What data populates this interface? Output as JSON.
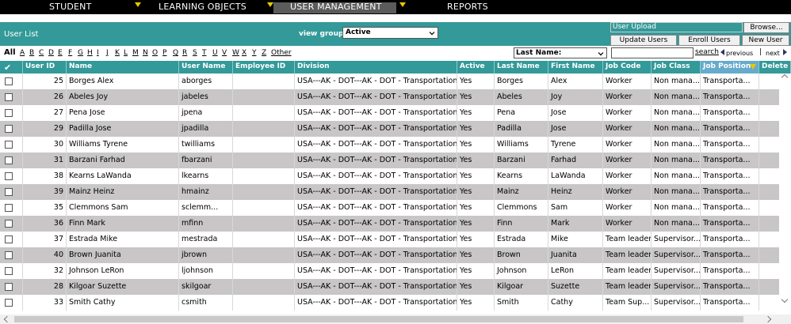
{
  "nav": {
    "items": [
      "STUDENT",
      "LEARNING OBJECTS",
      "USER MANAGEMENT",
      "REPORTS"
    ]
  },
  "header": {
    "title": "User List",
    "view_group_label": "view group",
    "view_group_value": "Active",
    "upload_label": "User Upload",
    "browse_label": "Browse...",
    "update_users_label": "Update Users",
    "enroll_users_label": "Enroll Users",
    "new_user_label": "New User"
  },
  "alpha": {
    "all_label": "All",
    "letters": [
      "A",
      "B",
      "C",
      "D",
      "E",
      "F",
      "G",
      "H",
      "I",
      "J",
      "K",
      "L",
      "M",
      "N",
      "O",
      "P",
      "Q",
      "R",
      "S",
      "T",
      "U",
      "V",
      "W",
      "X",
      "Y",
      "Z"
    ],
    "other_label": "Other"
  },
  "search": {
    "field_select": "Last Name:",
    "search_label": "search",
    "previous_label": "previous",
    "separator": "|",
    "next_label": "next"
  },
  "table": {
    "header_check": "✔",
    "columns": [
      "User ID",
      "Name",
      "User Name",
      "Employee ID",
      "Division",
      "Active",
      "Last Name",
      "First Name",
      "Job Code",
      "Job Class",
      "Job Position",
      "Delete"
    ],
    "rows": [
      {
        "id": "25",
        "name": "Borges Alex",
        "username": "aborges",
        "empid": "",
        "division": "USA---AK - DOT---AK - DOT - Transportation",
        "active": "Yes",
        "last": "Borges",
        "first": "Alex",
        "code": "Worker",
        "class": "Non mana...",
        "position": "Transporta..."
      },
      {
        "id": "26",
        "name": "Abeles Joy",
        "username": "jabeles",
        "empid": "",
        "division": "USA---AK - DOT---AK - DOT - Transportation",
        "active": "Yes",
        "last": "Abeles",
        "first": "Joy",
        "code": "Worker",
        "class": "Non mana...",
        "position": "Transporta..."
      },
      {
        "id": "27",
        "name": "Pena Jose",
        "username": "jpena",
        "empid": "",
        "division": "USA---AK - DOT---AK - DOT - Transportation",
        "active": "Yes",
        "last": "Pena",
        "first": "Jose",
        "code": "Worker",
        "class": "Non mana...",
        "position": "Transporta..."
      },
      {
        "id": "29",
        "name": "Padilla Jose",
        "username": "jpadilla",
        "empid": "",
        "division": "USA---AK - DOT---AK - DOT - Transportation",
        "active": "Yes",
        "last": "Padilla",
        "first": "Jose",
        "code": "Worker",
        "class": "Non mana...",
        "position": "Transporta..."
      },
      {
        "id": "30",
        "name": "Williams Tyrene",
        "username": "twilliams",
        "empid": "",
        "division": "USA---AK - DOT---AK - DOT - Transportation",
        "active": "Yes",
        "last": "Williams",
        "first": "Tyrene",
        "code": "Worker",
        "class": "Non mana...",
        "position": "Transporta..."
      },
      {
        "id": "31",
        "name": "Barzani Farhad",
        "username": "fbarzani",
        "empid": "",
        "division": "USA---AK - DOT---AK - DOT - Transportation",
        "active": "Yes",
        "last": "Barzani",
        "first": "Farhad",
        "code": "Worker",
        "class": "Non mana...",
        "position": "Transporta..."
      },
      {
        "id": "38",
        "name": "Kearns LaWanda",
        "username": "lkearns",
        "empid": "",
        "division": "USA---AK - DOT---AK - DOT - Transportation",
        "active": "Yes",
        "last": "Kearns",
        "first": "LaWanda",
        "code": "Worker",
        "class": "Non mana...",
        "position": "Transporta..."
      },
      {
        "id": "39",
        "name": "Mainz Heinz",
        "username": "hmainz",
        "empid": "",
        "division": "USA---AK - DOT---AK - DOT - Transportation",
        "active": "Yes",
        "last": "Mainz",
        "first": "Heinz",
        "code": "Worker",
        "class": "Non mana...",
        "position": "Transporta..."
      },
      {
        "id": "35",
        "name": "Clemmons Sam",
        "username": "sclemm...",
        "empid": "",
        "division": "USA---AK - DOT---AK - DOT - Transportation",
        "active": "Yes",
        "last": "Clemmons",
        "first": "Sam",
        "code": "Worker",
        "class": "Non mana...",
        "position": "Transporta..."
      },
      {
        "id": "36",
        "name": "Finn Mark",
        "username": "mfinn",
        "empid": "",
        "division": "USA---AK - DOT---AK - DOT - Transportation",
        "active": "Yes",
        "last": "Finn",
        "first": "Mark",
        "code": "Worker",
        "class": "Non mana...",
        "position": "Transporta..."
      },
      {
        "id": "37",
        "name": "Estrada Mike",
        "username": "mestrada",
        "empid": "",
        "division": "USA---AK - DOT---AK - DOT - Transportation",
        "active": "Yes",
        "last": "Estrada",
        "first": "Mike",
        "code": "Team leader",
        "class": "Supervisor...",
        "position": "Transporta..."
      },
      {
        "id": "40",
        "name": "Brown Juanita",
        "username": "jbrown",
        "empid": "",
        "division": "USA---AK - DOT---AK - DOT - Transportation",
        "active": "Yes",
        "last": "Brown",
        "first": "Juanita",
        "code": "Team leader",
        "class": "Supervisor...",
        "position": "Transporta..."
      },
      {
        "id": "32",
        "name": "Johnson LeRon",
        "username": "ljohnson",
        "empid": "",
        "division": "USA---AK - DOT---AK - DOT - Transportation",
        "active": "Yes",
        "last": "Johnson",
        "first": "LeRon",
        "code": "Team leader",
        "class": "Supervisor...",
        "position": "Transporta..."
      },
      {
        "id": "28",
        "name": "Kilgoar Suzette",
        "username": "skilgoar",
        "empid": "",
        "division": "USA---AK - DOT---AK - DOT - Transportation",
        "active": "Yes",
        "last": "Kilgoar",
        "first": "Suzette",
        "code": "Team leader",
        "class": "Supervisor...",
        "position": "Transporta..."
      },
      {
        "id": "33",
        "name": "Smith Cathy",
        "username": "csmith",
        "empid": "",
        "division": "USA---AK - DOT---AK - DOT - Transportation",
        "active": "Yes",
        "last": "Smith",
        "first": "Cathy",
        "code": "Team Sup...",
        "class": "Supervisor...",
        "position": "Transporta..."
      }
    ]
  },
  "colors": {
    "teal": "#339999",
    "row_alt": "#c8c6c6",
    "nav_bg": "#000000",
    "arrow": "#e8c800"
  }
}
